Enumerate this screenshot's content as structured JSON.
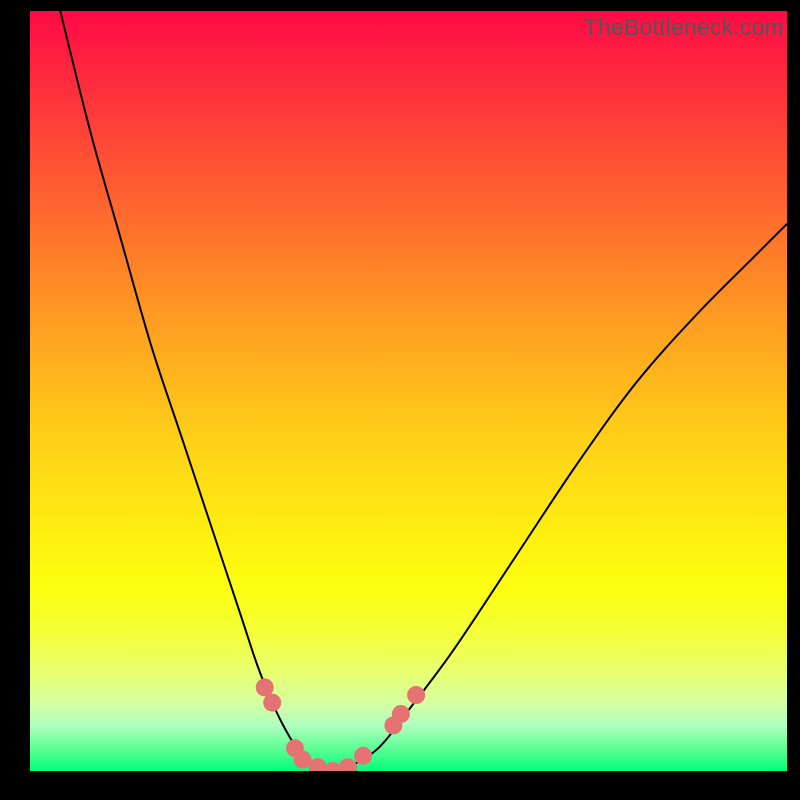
{
  "watermark": {
    "text": "TheBottleneck.com"
  },
  "chart_data": {
    "type": "line",
    "title": "",
    "xlabel": "",
    "ylabel": "",
    "xlim": [
      0,
      100
    ],
    "ylim": [
      0,
      100
    ],
    "grid": false,
    "legend": false,
    "series": [
      {
        "name": "bottleneck-curve",
        "x": [
          4,
          8,
          12,
          16,
          20,
          24,
          28,
          30,
          32,
          34,
          36,
          38,
          40,
          42,
          46,
          50,
          56,
          64,
          72,
          80,
          88,
          96,
          100
        ],
        "values": [
          100,
          84,
          70,
          56,
          44,
          32,
          20,
          14,
          9,
          5,
          2,
          0.5,
          0,
          0.5,
          3,
          8,
          16,
          28,
          40,
          51,
          60,
          68,
          72
        ]
      }
    ],
    "markers": {
      "name": "highlight-dots",
      "color": "#e57373",
      "points": [
        {
          "x": 31,
          "y": 11
        },
        {
          "x": 32,
          "y": 9
        },
        {
          "x": 35,
          "y": 3
        },
        {
          "x": 36,
          "y": 1.5
        },
        {
          "x": 38,
          "y": 0.5
        },
        {
          "x": 40,
          "y": 0
        },
        {
          "x": 42,
          "y": 0.5
        },
        {
          "x": 44,
          "y": 2
        },
        {
          "x": 48,
          "y": 6
        },
        {
          "x": 49,
          "y": 7.5
        },
        {
          "x": 51,
          "y": 10
        }
      ]
    },
    "background_gradient": {
      "top": "#ff0a46",
      "mid": "#fff210",
      "bottom": "#00ff7a"
    }
  }
}
